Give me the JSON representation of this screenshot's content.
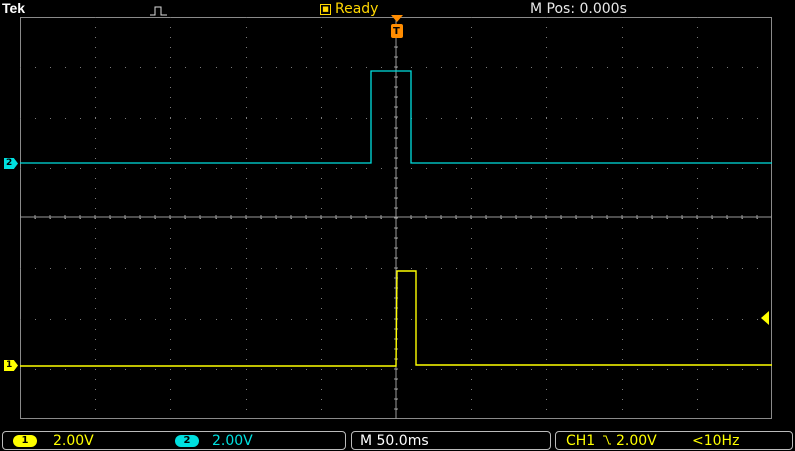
{
  "header": {
    "brand": "Tek",
    "status": "Ready",
    "status_icon": "stop-square-icon",
    "position_readout": "M Pos: 0.000s"
  },
  "colors": {
    "ch1": "#ffff00",
    "ch2": "#00e0e0",
    "trigger": "#ff8c00",
    "grid": "#8a8a8a",
    "status_text": "#ffd700"
  },
  "markers": {
    "ch1": "1",
    "ch2": "2",
    "trigger": "T"
  },
  "statusbar": {
    "ch1_label": "1",
    "ch1_scale": "2.00V",
    "ch2_label": "2",
    "ch2_scale": "2.00V",
    "timebase": "M 50.0ms",
    "trigger_source": "CH1",
    "trigger_slope_icon": "falling-edge-icon",
    "trigger_level": "2.00V",
    "trigger_freq": "<10Hz"
  }
}
